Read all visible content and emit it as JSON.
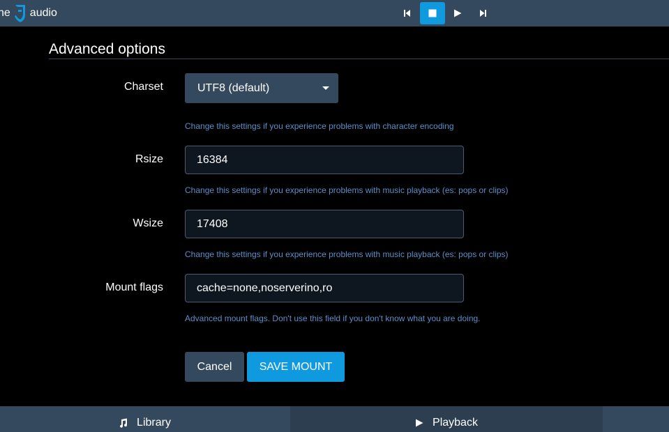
{
  "header": {
    "brand_pre": "ne",
    "brand_text": "audio",
    "controls": {
      "prev": "skip-previous-icon",
      "stop": "stop-icon",
      "play": "play-icon",
      "next": "skip-next-icon"
    }
  },
  "section": {
    "title": "Advanced options"
  },
  "form": {
    "charset": {
      "label": "Charset",
      "value": "UTF8 (default)",
      "help": "Change this settings if you experience problems with character encoding"
    },
    "rsize": {
      "label": "Rsize",
      "value": "16384",
      "help": "Change this settings if you experience problems with music playback (es: pops or clips)"
    },
    "wsize": {
      "label": "Wsize",
      "value": "17408",
      "help": "Change this settings if you experience problems with music playback (es: pops or clips)"
    },
    "mount_flags": {
      "label": "Mount flags",
      "value": "cache=none,noserverino,ro",
      "help": "Advanced mount flags. Don't use this field if you don't know what you are doing."
    }
  },
  "actions": {
    "cancel": "Cancel",
    "save": "SAVE MOUNT"
  },
  "footer": {
    "library": "Library",
    "playback": "Playback"
  },
  "colors": {
    "bar": "#34495e",
    "accent": "#0f9ae0",
    "help_text": "#5b8fc9"
  }
}
